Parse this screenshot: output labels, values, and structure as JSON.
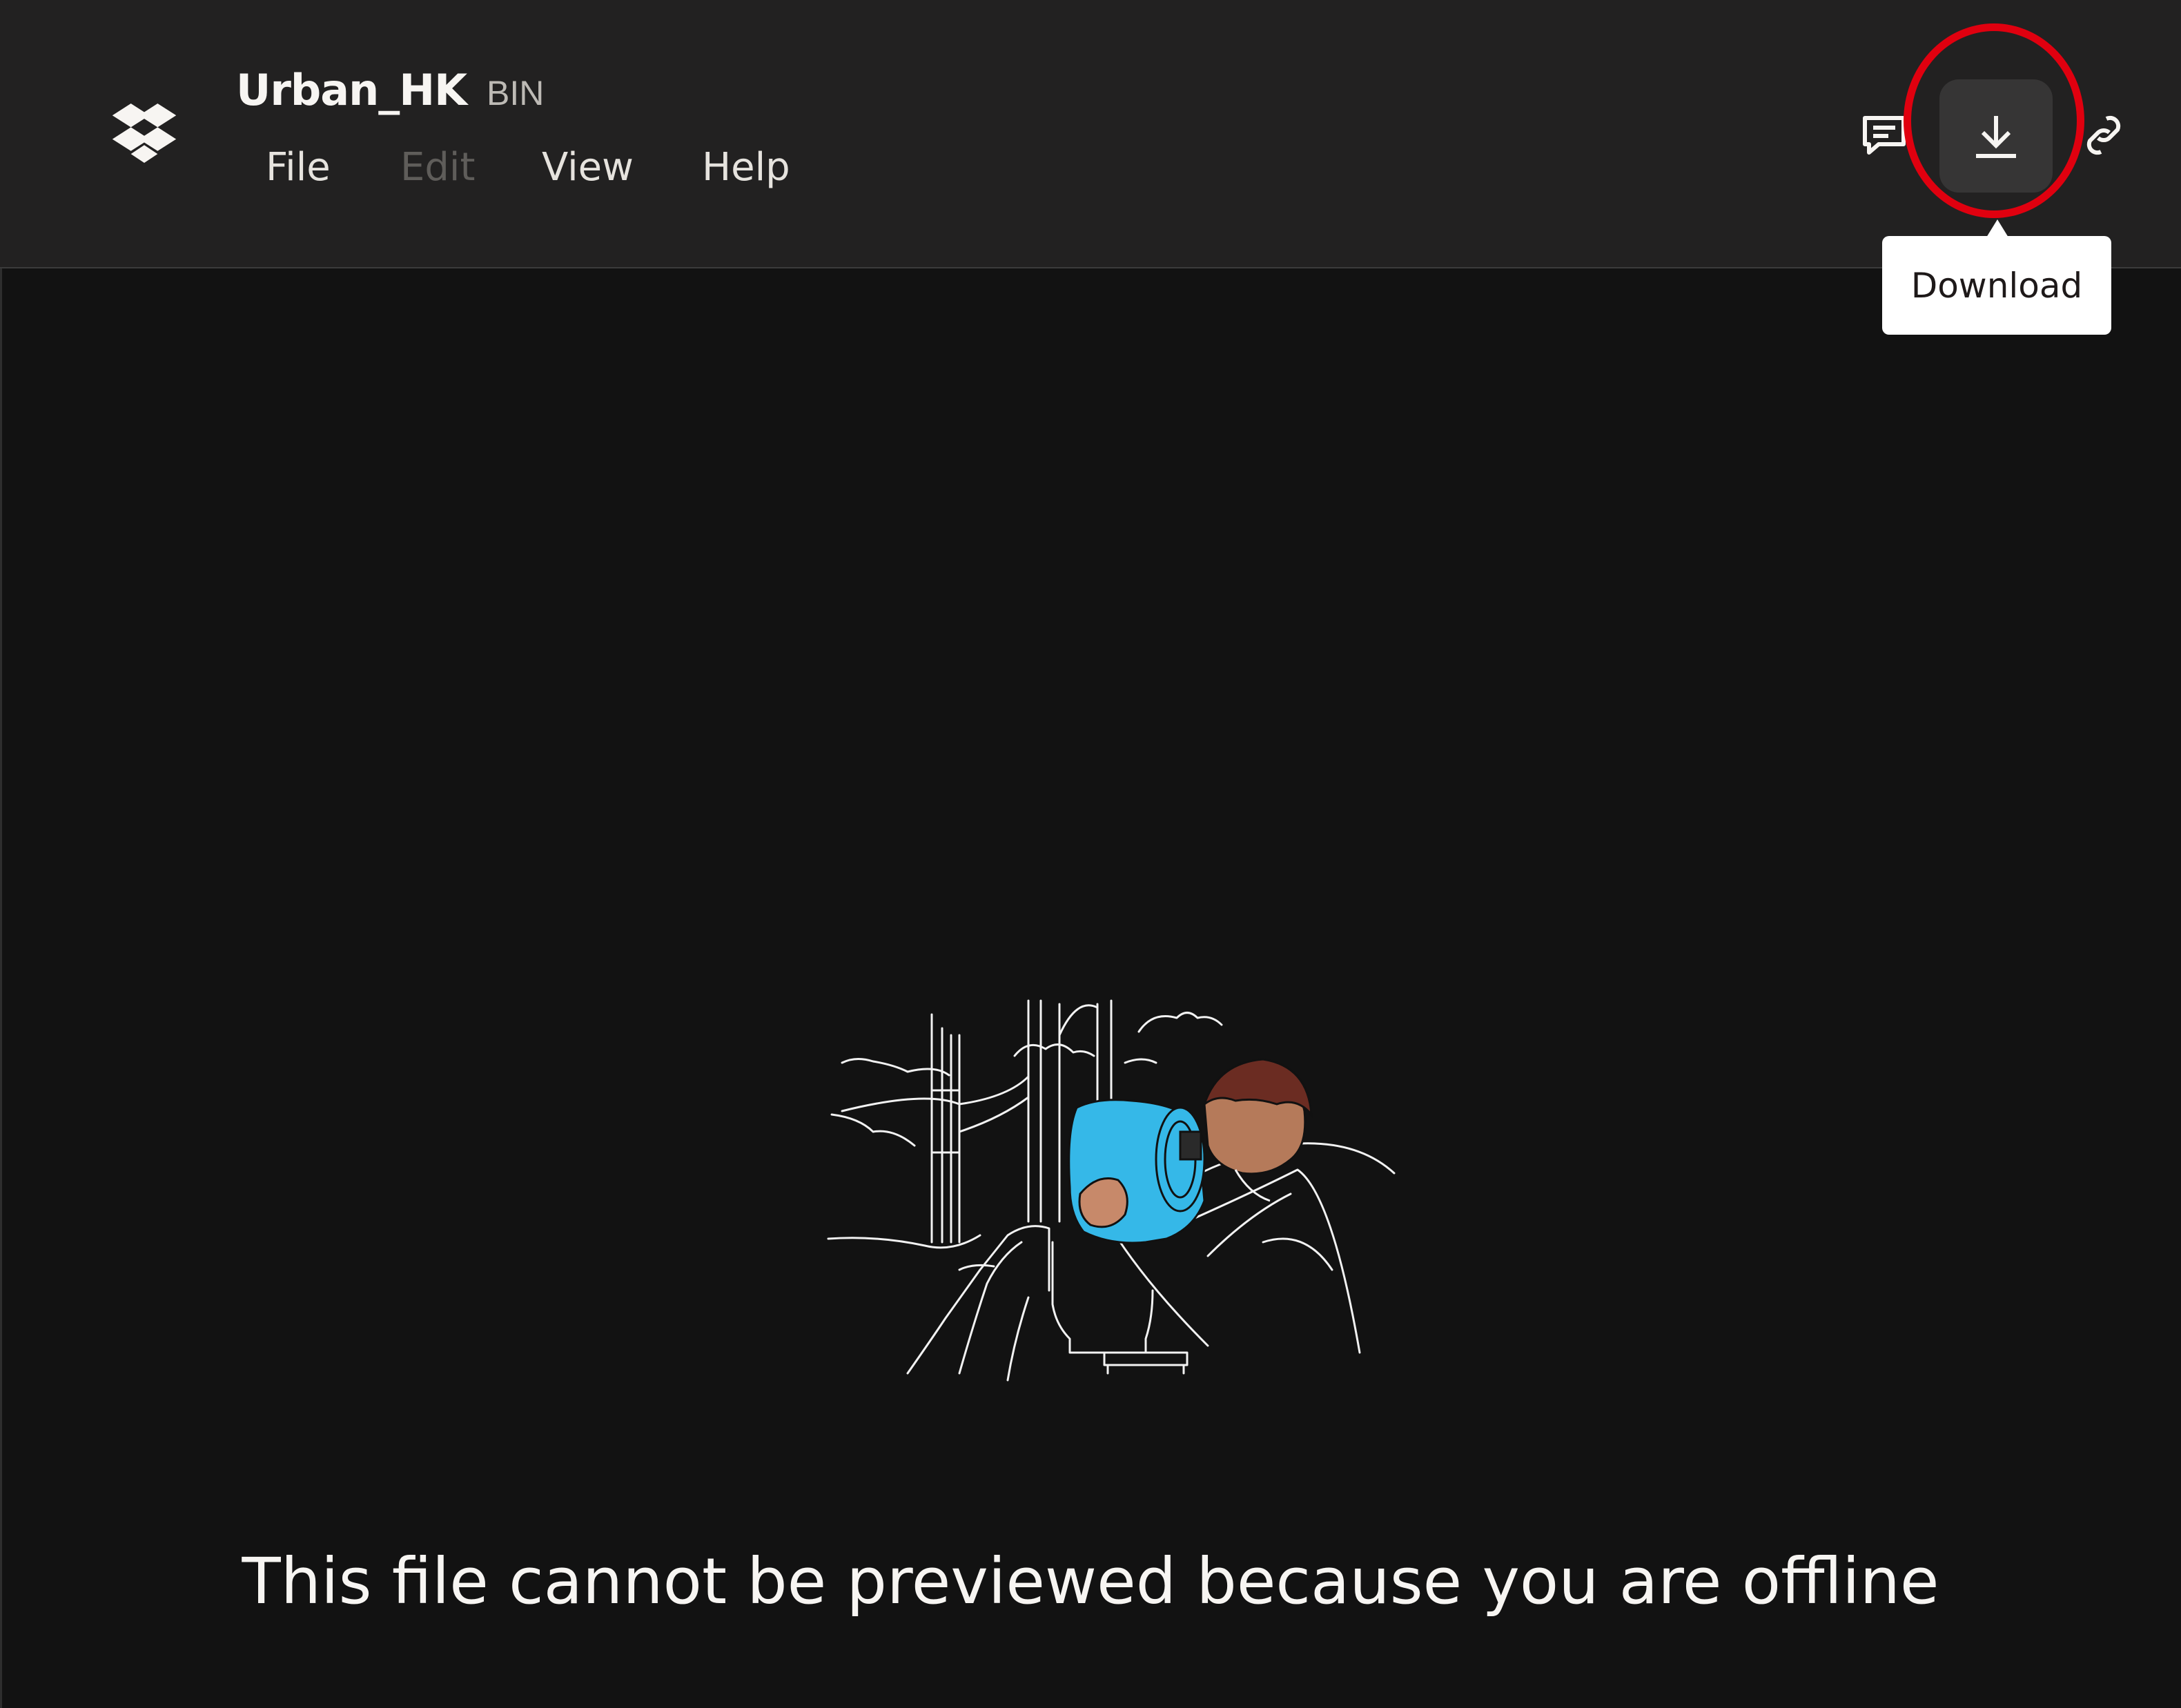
{
  "file": {
    "name": "Urban_HK",
    "extension": "BIN"
  },
  "menu": {
    "items": [
      {
        "label": "File",
        "enabled": true
      },
      {
        "label": "Edit",
        "enabled": false
      },
      {
        "label": "View",
        "enabled": true
      },
      {
        "label": "Help",
        "enabled": true
      }
    ]
  },
  "toolbar": {
    "comment_icon": "comment-icon",
    "download_icon": "download-icon",
    "link_icon": "link-icon",
    "download_tooltip": "Download"
  },
  "preview": {
    "message": "This file cannot be previewed because you are offline",
    "illustration": "person-looking-through-binocular-viewer-illustration"
  },
  "colors": {
    "topbar_bg": "#222121",
    "canvas_bg": "#121212",
    "text_primary": "#f7f5f2",
    "menu_disabled": "#5f5d5a",
    "download_button_bg": "#363535",
    "highlight_ring": "#e0000f",
    "tooltip_bg": "#ffffff",
    "illustration_accent": "#35b8e8"
  }
}
